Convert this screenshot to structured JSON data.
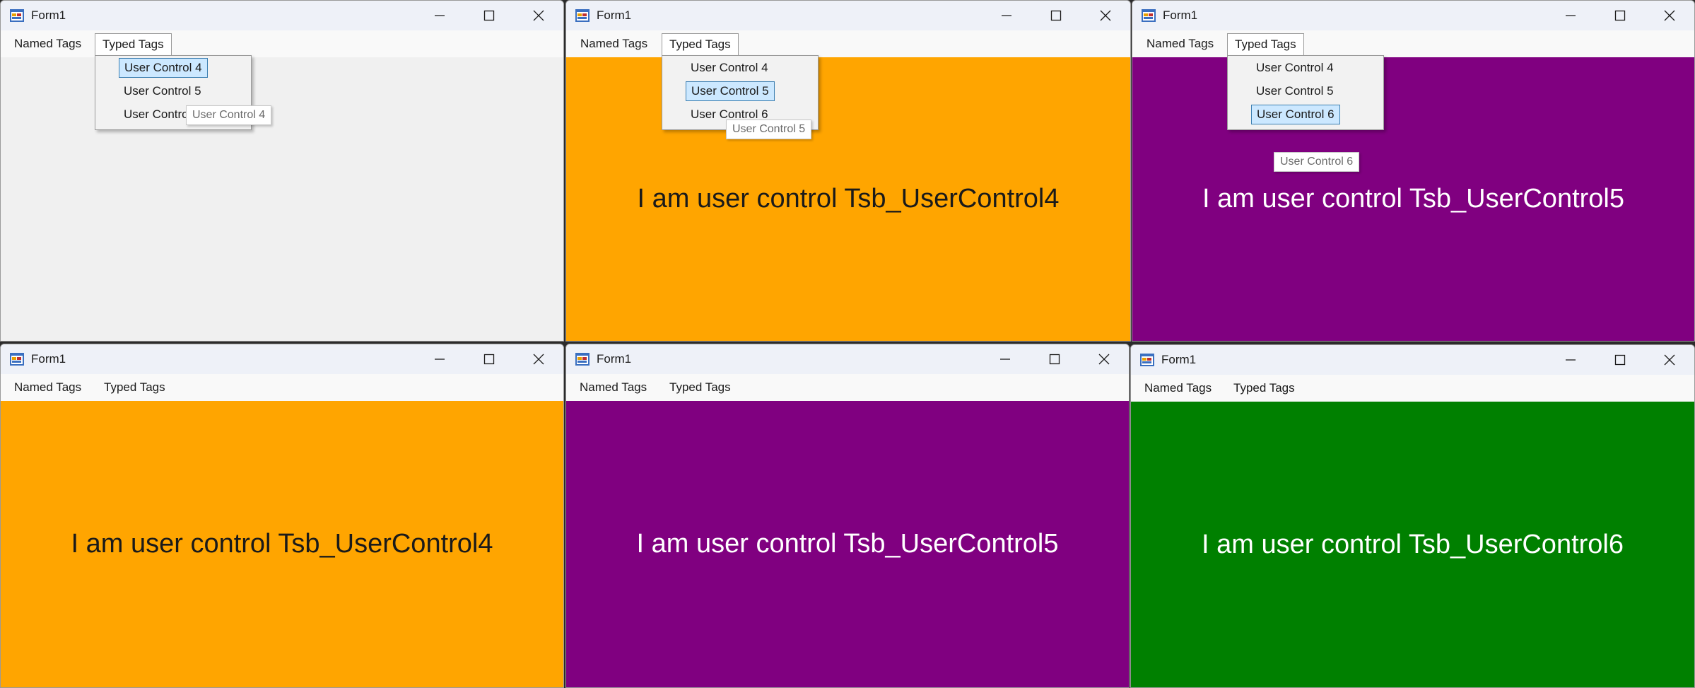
{
  "colors": {
    "orange": "#ffa500",
    "purple": "#800080",
    "green": "#008000",
    "empty": "#f0f0f0",
    "dark_text": "#1a1a1a",
    "light_text": "#ffffff"
  },
  "common": {
    "title": "Form1",
    "app_icon": "form-app-icon",
    "menu_named": "Named Tags",
    "menu_typed": "Typed Tags",
    "dropdown_items": [
      "User Control 4",
      "User Control 5",
      "User Control 6"
    ]
  },
  "windows": [
    {
      "content": "",
      "background": "#f0f0f0",
      "dropdown_open": true,
      "highlighted": "User Control 4",
      "tooltip": "User Control 4"
    },
    {
      "content": "I am user control Tsb_UserControl4",
      "background": "#ffa500",
      "dropdown_open": true,
      "highlighted": "User Control 5",
      "tooltip": "User Control 5"
    },
    {
      "content": "I am user control Tsb_UserControl5",
      "background": "#800080",
      "dropdown_open": true,
      "highlighted": "User Control 6",
      "tooltip": "User Control 6"
    },
    {
      "content": "I am user control Tsb_UserControl4",
      "background": "#ffa500",
      "dropdown_open": false
    },
    {
      "content": "I am user control Tsb_UserControl5",
      "background": "#800080",
      "dropdown_open": false
    },
    {
      "content": "I am user control Tsb_UserControl6",
      "background": "#008000",
      "dropdown_open": false
    }
  ]
}
